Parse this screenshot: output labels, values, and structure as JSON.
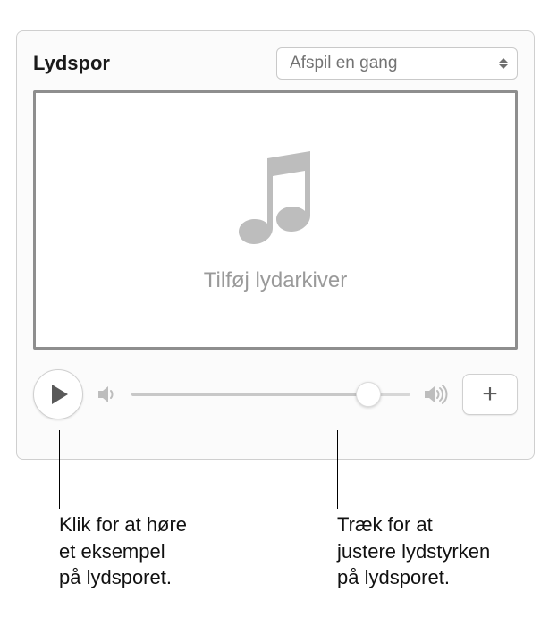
{
  "panel": {
    "title": "Lydspor",
    "playback_mode": {
      "selected": "Afspil en gang"
    },
    "dropzone": {
      "label": "Tilføj lydarkiver"
    },
    "controls": {
      "add_symbol": "+"
    }
  },
  "callouts": {
    "play": "Klik for at høre\net eksempel\npå lydsporet.",
    "volume": "Træk for at\njustere lydstyrken\npå lydsporet."
  }
}
